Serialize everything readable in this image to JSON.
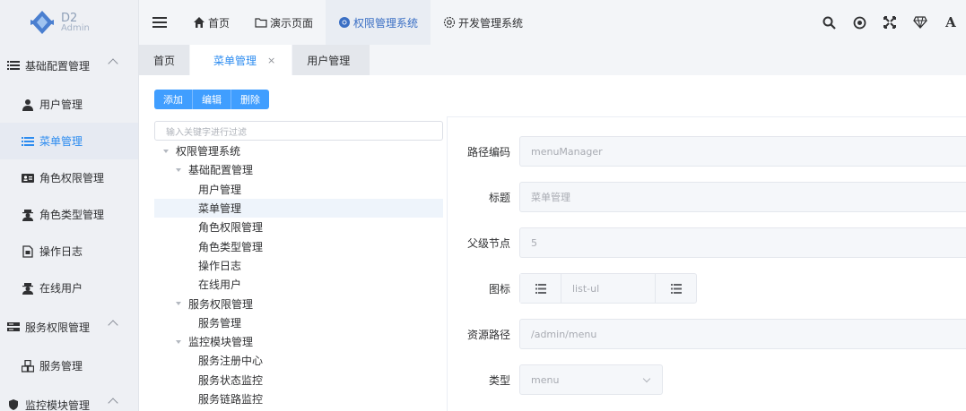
{
  "app": {
    "logo_line1": "D2",
    "logo_line2": "Admin"
  },
  "topnav": {
    "items": [
      {
        "label": "首页",
        "icon": "home-icon"
      },
      {
        "label": "演示页面",
        "icon": "folder-icon"
      },
      {
        "label": "权限管理系统",
        "icon": "chrome-icon",
        "active": true
      },
      {
        "label": "开发管理系统",
        "icon": "gear-icon"
      }
    ],
    "right_icons": [
      "search-icon",
      "target-icon",
      "fullscreen-icon",
      "diamond-icon",
      "font-icon"
    ],
    "font_icon_text": "A"
  },
  "sidebar": {
    "group1": "基础配置管理",
    "items": [
      {
        "label": "用户管理",
        "icon": "user-icon"
      },
      {
        "label": "菜单管理",
        "icon": "list-icon",
        "active": true
      },
      {
        "label": "角色权限管理",
        "icon": "id-card-icon"
      },
      {
        "label": "角色类型管理",
        "icon": "user-secret-icon"
      },
      {
        "label": "操作日志",
        "icon": "file-icon"
      },
      {
        "label": "在线用户",
        "icon": "user-secret-icon"
      }
    ],
    "group2": "服务权限管理",
    "group2_items": [
      {
        "label": "服务管理",
        "icon": "cubes-icon"
      }
    ],
    "group3": "监控模块管理"
  },
  "tabs": [
    {
      "label": "首页"
    },
    {
      "label": "菜单管理",
      "active": true,
      "close": "×"
    },
    {
      "label": "用户管理"
    }
  ],
  "toolbar": {
    "add": "添加",
    "edit": "编辑",
    "delete": "删除"
  },
  "filter": {
    "placeholder": "输入关键字进行过滤"
  },
  "tree": [
    {
      "label": "权限管理系统",
      "level": 0,
      "expand": true
    },
    {
      "label": "基础配置管理",
      "level": 1,
      "expand": true
    },
    {
      "label": "用户管理",
      "level": 2
    },
    {
      "label": "菜单管理",
      "level": 2,
      "selected": true
    },
    {
      "label": "角色权限管理",
      "level": 2
    },
    {
      "label": "角色类型管理",
      "level": 2
    },
    {
      "label": "操作日志",
      "level": 2
    },
    {
      "label": "在线用户",
      "level": 2
    },
    {
      "label": "服务权限管理",
      "level": 1,
      "expand": true
    },
    {
      "label": "服务管理",
      "level": 2
    },
    {
      "label": "监控模块管理",
      "level": 1,
      "expand": true
    },
    {
      "label": "服务注册中心",
      "level": 2
    },
    {
      "label": "服务状态监控",
      "level": 2
    },
    {
      "label": "服务链路监控",
      "level": 2
    }
  ],
  "form": {
    "path_code_label": "路径编码",
    "path_code_value": "menuManager",
    "title_label": "标题",
    "title_value": "菜单管理",
    "parent_label": "父级节点",
    "parent_value": "5",
    "icon_label": "图标",
    "icon_value": "list-ul",
    "resource_label": "资源路径",
    "resource_value": "/admin/menu",
    "type_label": "类型",
    "type_value": "menu"
  },
  "colors": {
    "accent": "#409eff",
    "active_text": "#2d8cf0",
    "sidebar_bg": "#eef0f4"
  }
}
